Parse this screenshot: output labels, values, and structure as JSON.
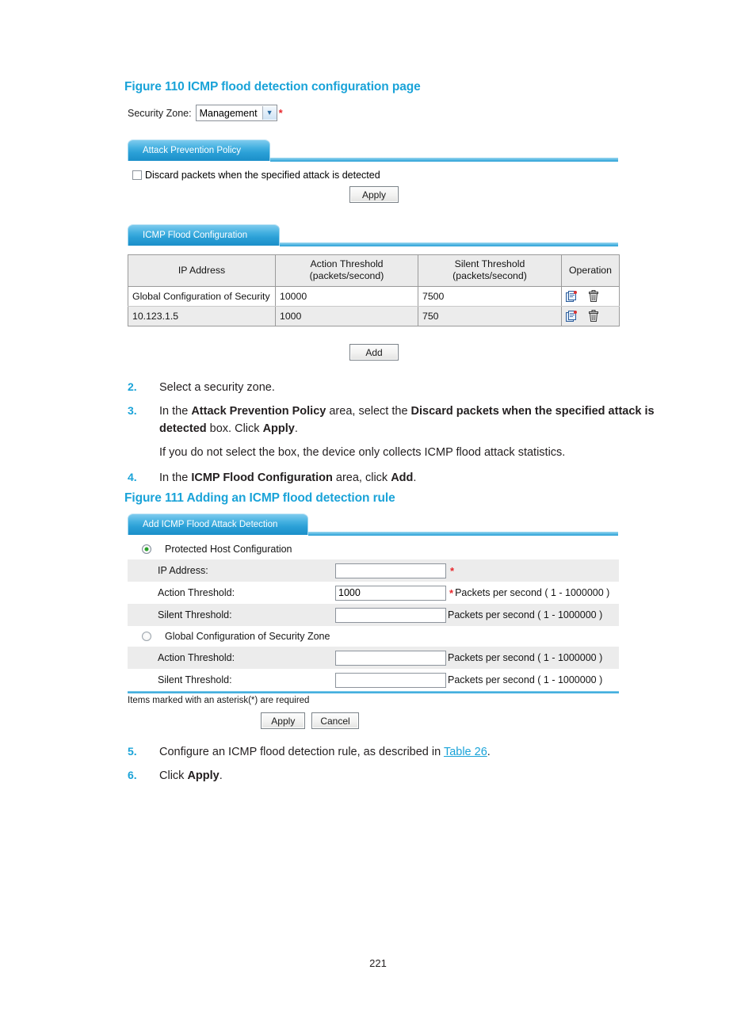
{
  "figure110": {
    "caption": "Figure 110 ICMP flood detection configuration page",
    "security_zone": {
      "label": "Security Zone:",
      "selected": "Management",
      "required_marker": "*",
      "arrow_icon": "chevron-down-icon"
    },
    "attack_prevention_policy": {
      "tab_label": "Attack Prevention Policy",
      "checkbox_label": "Discard packets when the specified attack is detected",
      "checkbox_checked": false,
      "apply_label": "Apply"
    },
    "icmp_flood_configuration": {
      "tab_label": "ICMP Flood Configuration",
      "columns": [
        "IP Address",
        "Action Threshold\n(packets/second)",
        "Silent Threshold\n(packets/second)",
        "Operation"
      ],
      "column_headers": {
        "ip_address": "IP Address",
        "action_threshold_l1": "Action Threshold",
        "action_threshold_l2": "(packets/second)",
        "silent_threshold_l1": "Silent Threshold",
        "silent_threshold_l2": "(packets/second)",
        "operation": "Operation"
      },
      "rows": [
        {
          "ip_address": "Global Configuration of Security",
          "action_threshold": "10000",
          "silent_threshold": "7500",
          "edit_icon": "edit-icon",
          "delete_icon": "trash-icon"
        },
        {
          "ip_address": "10.123.1.5",
          "action_threshold": "1000",
          "silent_threshold": "750",
          "edit_icon": "edit-icon",
          "delete_icon": "trash-icon"
        }
      ],
      "add_label": "Add"
    }
  },
  "steps_mid": {
    "s2": {
      "num": "2.",
      "text": "Select a security zone."
    },
    "s3": {
      "num": "3.",
      "t1": "In the ",
      "b1": "Attack Prevention Policy",
      "t2": " area, select the ",
      "b2": "Discard packets when the specified attack is detected",
      "t3": " box. Click ",
      "b3": "Apply",
      "t4": ".",
      "note": "If you do not select the box, the device only collects ICMP flood attack statistics."
    },
    "s4": {
      "num": "4.",
      "t1": "In the ",
      "b1": "ICMP Flood Configuration",
      "t2": " area, click ",
      "b2": "Add",
      "t3": "."
    }
  },
  "figure111": {
    "caption": "Figure 111 Adding an ICMP flood detection rule",
    "tab_label": "Add ICMP Flood Attack Detection",
    "protected_host": {
      "radio_label": "Protected Host Configuration",
      "selected": true,
      "fields": [
        {
          "label": "IP Address:",
          "value": "",
          "star": "*",
          "hint": ""
        },
        {
          "label": "Action Threshold:",
          "value": "1000",
          "star": "*",
          "hint": "Packets per second ( 1 - 1000000 )"
        },
        {
          "label": "Silent Threshold:",
          "value": "",
          "star": "",
          "hint": "Packets per second ( 1 - 1000000 )"
        }
      ]
    },
    "global_zone": {
      "radio_label": "Global Configuration of Security Zone",
      "selected": false,
      "fields": [
        {
          "label": "Action Threshold:",
          "value": "",
          "star": "",
          "hint": "Packets per second ( 1 - 1000000 )"
        },
        {
          "label": "Silent Threshold:",
          "value": "",
          "star": "",
          "hint": "Packets per second ( 1 - 1000000 )"
        }
      ]
    },
    "required_note": "Items marked with an asterisk(*) are required",
    "apply_label": "Apply",
    "cancel_label": "Cancel"
  },
  "steps_end": {
    "s5": {
      "num": "5.",
      "t1": "Configure an ICMP flood detection rule, as described in ",
      "link": "Table 26",
      "t2": "."
    },
    "s6": {
      "num": "6.",
      "t1": "Click ",
      "b1": "Apply",
      "t2": "."
    }
  },
  "footer": {
    "page_number": "221"
  },
  "colors": {
    "accent": "#1aa3d8",
    "tab_blue": "#2a9fd6",
    "required_red": "#e8272c",
    "row_shade": "#ececec",
    "header_gray": "#ebebeb"
  }
}
